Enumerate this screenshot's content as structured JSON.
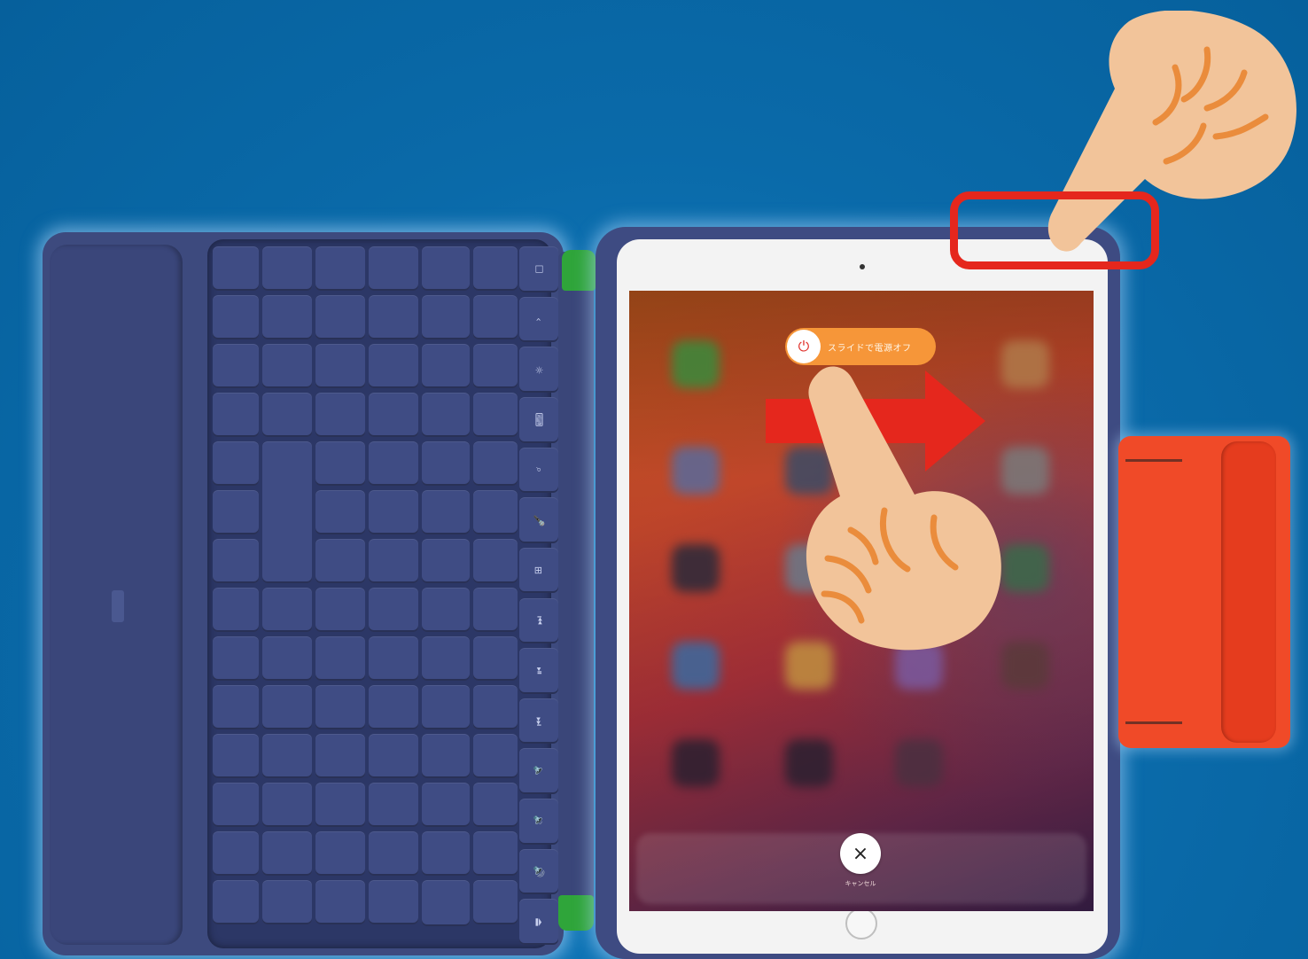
{
  "colors": {
    "background": "#0a6aa9",
    "highlight": "#e5271d",
    "arrow": "#e5271d",
    "keyboard": "#3d4a7e",
    "strap": "#f04a28",
    "slider": "#ffa03c"
  },
  "power_slider": {
    "icon": "power-icon",
    "label": "スライドで電源オフ"
  },
  "cancel": {
    "icon": "close-icon",
    "symbol": "×",
    "label": "キャンセル"
  },
  "annotations": {
    "pointing_hand_top": "pointing-hand-icon",
    "pointing_hand_screen": "pointing-hand-icon",
    "swipe_arrow": "right-arrow-icon",
    "power_button_highlight": "highlight-box"
  },
  "keyboard": {
    "column_right_keys": [
      "☐",
      "‹",
      "☼",
      "⌨",
      "⌕",
      "🎤",
      "⊞",
      "⏮",
      "⏯",
      "⏭",
      "🔈",
      "🔉",
      "🔊",
      "⏏"
    ]
  }
}
